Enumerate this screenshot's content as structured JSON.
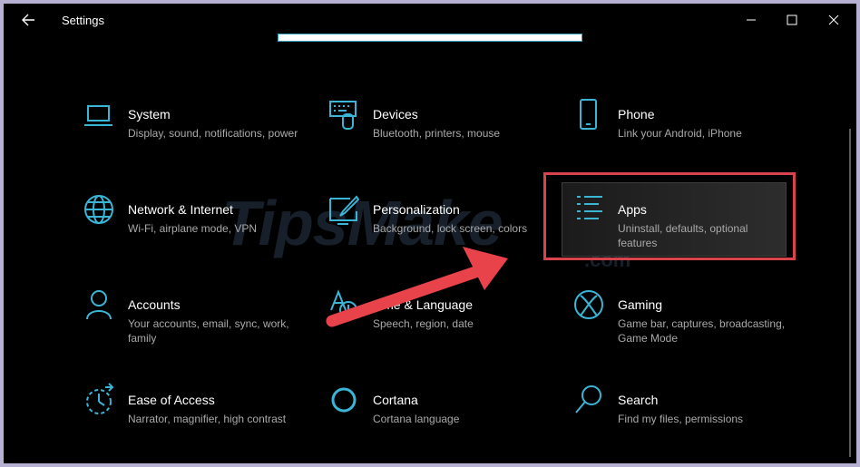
{
  "window": {
    "title": "Settings"
  },
  "tiles": [
    {
      "name": "System",
      "desc": "Display, sound, notifications, power",
      "icon": "laptop-icon"
    },
    {
      "name": "Devices",
      "desc": "Bluetooth, printers, mouse",
      "icon": "keyboard-icon"
    },
    {
      "name": "Phone",
      "desc": "Link your Android, iPhone",
      "icon": "phone-icon"
    },
    {
      "name": "Network & Internet",
      "desc": "Wi-Fi, airplane mode, VPN",
      "icon": "globe-icon"
    },
    {
      "name": "Personalization",
      "desc": "Background, lock screen, colors",
      "icon": "paint-brush-icon"
    },
    {
      "name": "Apps",
      "desc": "Uninstall, defaults, optional features",
      "icon": "apps-list-icon"
    },
    {
      "name": "Accounts",
      "desc": "Your accounts, email, sync, work, family",
      "icon": "person-icon"
    },
    {
      "name": "Time & Language",
      "desc": "Speech, region, date",
      "icon": "time-language-icon"
    },
    {
      "name": "Gaming",
      "desc": "Game bar, captures, broadcasting, Game Mode",
      "icon": "xbox-icon"
    },
    {
      "name": "Ease of Access",
      "desc": "Narrator, magnifier, high contrast",
      "icon": "ease-of-access-icon"
    },
    {
      "name": "Cortana",
      "desc": "Cortana language",
      "icon": "cortana-icon"
    },
    {
      "name": "Search",
      "desc": "Find my files, permissions",
      "icon": "search-icon"
    }
  ],
  "watermark": {
    "text": "TipsMake",
    "domain": ".com"
  },
  "colors": {
    "accent": "#3ab5d6",
    "highlight": "#d9444c",
    "background": "#000000"
  }
}
